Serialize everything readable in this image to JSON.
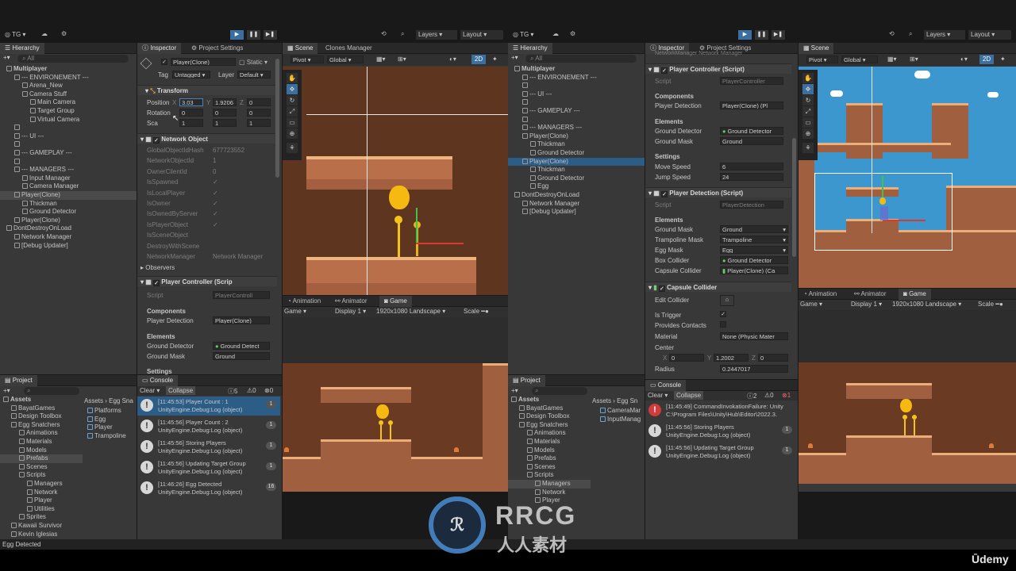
{
  "watermark": {
    "text": "RRCG",
    "sub": "人人素材",
    "udemy": "Ūdemy"
  },
  "status": {
    "text": "Egg Detected"
  },
  "left": {
    "toolbar": {
      "account": "TG",
      "layers": "Layers",
      "layout": "Layout"
    },
    "hierarchy": {
      "tab": "Hierarchy",
      "search": "All",
      "items": [
        {
          "label": "Multiplayer",
          "indent": 0,
          "bold": true
        },
        {
          "label": "--- ENVIRONEMENT ---",
          "indent": 1
        },
        {
          "label": "Arena_New",
          "indent": 2
        },
        {
          "label": "Camera Stuff",
          "indent": 2
        },
        {
          "label": "Main Camera",
          "indent": 3
        },
        {
          "label": "Target Group",
          "indent": 3
        },
        {
          "label": "Virtual Camera",
          "indent": 3
        },
        {
          "label": "",
          "indent": 1
        },
        {
          "label": "--- UI ---",
          "indent": 1
        },
        {
          "label": "",
          "indent": 1
        },
        {
          "label": "--- GAMEPLAY ---",
          "indent": 1
        },
        {
          "label": "",
          "indent": 1
        },
        {
          "label": "--- MANAGERS ---",
          "indent": 1
        },
        {
          "label": "Input Manager",
          "indent": 2
        },
        {
          "label": "Camera Manager",
          "indent": 2
        },
        {
          "label": "Player(Clone)",
          "indent": 1,
          "hl": true
        },
        {
          "label": "Thickman",
          "indent": 2
        },
        {
          "label": "Ground Detector",
          "indent": 2
        },
        {
          "label": "Player(Clone)",
          "indent": 1
        },
        {
          "label": "DontDestroyOnLoad",
          "indent": 0
        },
        {
          "label": "Network Manager",
          "indent": 1
        },
        {
          "label": "[Debug Updater]",
          "indent": 1
        }
      ]
    },
    "inspector": {
      "tabs": [
        "Inspector",
        "Project Settings"
      ],
      "object": "Player(Clone)",
      "static": "Static",
      "tag_label": "Tag",
      "tag": "Untagged",
      "layer_label": "Layer",
      "layer": "Default",
      "transform": {
        "title": "Transform",
        "position": "Position",
        "rotation": "Rotation",
        "scale": "Sca",
        "px": "3.03",
        "py": "1.9206",
        "pz": "0",
        "rx": "0",
        "ry": "0",
        "rz": "0",
        "sx": "1",
        "sy": "1",
        "sz": "1"
      },
      "network": {
        "title": "Network Object",
        "fields": [
          {
            "k": "GlobalObjectIdHash",
            "v": "677723552"
          },
          {
            "k": "NetworkObjectId",
            "v": "1"
          },
          {
            "k": "OwnerClientId",
            "v": "0"
          },
          {
            "k": "IsSpawned",
            "v": "✓"
          },
          {
            "k": "IsLocalPlayer",
            "v": "✓"
          },
          {
            "k": "IsOwner",
            "v": "✓"
          },
          {
            "k": "IsOwnedByServer",
            "v": "✓"
          },
          {
            "k": "IsPlayerObject",
            "v": "✓"
          },
          {
            "k": "IsSceneObject",
            "v": ""
          },
          {
            "k": "DestroyWithScene",
            "v": ""
          },
          {
            "k": "NetworkManager",
            "v": "Network Manager"
          }
        ]
      },
      "observers": "Observers",
      "player_controller": {
        "title": "Player Controller (Scrip",
        "script_label": "Script",
        "script": "PlayerControll",
        "components": "Components",
        "player_detection_label": "Player Detection",
        "player_detection": "Player(Clone)",
        "elements": "Elements",
        "ground_detector_label": "Ground Detector",
        "ground_detector": "Ground Detect",
        "ground_mask_label": "Ground Mask",
        "ground_mask": "Ground",
        "settings": "Settings"
      }
    },
    "scene": {
      "tabs": [
        "Scene",
        "Clones Manager"
      ],
      "pivot": "Pivot",
      "global": "Global",
      "mode2d": "2D"
    },
    "game": {
      "tabs": [
        "Animation",
        "Animator",
        "Game"
      ],
      "display_mode": "Game",
      "display": "Display 1",
      "resolution": "1920x1080 Landscape",
      "scale": "Scale"
    },
    "project": {
      "tab": "Project",
      "breadcrumb": [
        "Assets",
        "Egg Sna"
      ],
      "tree": [
        {
          "label": "Assets",
          "indent": 0,
          "bold": true
        },
        {
          "label": "BayatGames",
          "indent": 1
        },
        {
          "label": "Design Toolbox",
          "indent": 1
        },
        {
          "label": "Egg Snatchers",
          "indent": 1
        },
        {
          "label": "Animations",
          "indent": 2
        },
        {
          "label": "Materials",
          "indent": 2
        },
        {
          "label": "Models",
          "indent": 2
        },
        {
          "label": "Prefabs",
          "indent": 2,
          "hl": true
        },
        {
          "label": "Scenes",
          "indent": 2
        },
        {
          "label": "Scripts",
          "indent": 2
        },
        {
          "label": "Managers",
          "indent": 3
        },
        {
          "label": "Network",
          "indent": 3
        },
        {
          "label": "Player",
          "indent": 3
        },
        {
          "label": "Utilities",
          "indent": 3
        },
        {
          "label": "Sprites",
          "indent": 2
        },
        {
          "label": "Kawaii Survivor",
          "indent": 1
        },
        {
          "label": "Kevin Iglesias",
          "indent": 1
        }
      ],
      "files": [
        "Platforms",
        "Egg",
        "Player",
        "Trampoline"
      ]
    },
    "console": {
      "tab": "Console",
      "clear": "Clear",
      "collapse": "Collapse",
      "c_info": "5",
      "c_warn": "0",
      "c_err": "0",
      "messages": [
        {
          "time": "[11:45:53] Player Count : 1",
          "src": "UnityEngine.Debug:Log (object)",
          "count": "1",
          "sel": true
        },
        {
          "time": "[11:45:56] Player Count : 2",
          "src": "UnityEngine.Debug:Log (object)",
          "count": "1"
        },
        {
          "time": "[11:45:56] Storing Players",
          "src": "UnityEngine.Debug:Log (object)",
          "count": "1"
        },
        {
          "time": "[11:45:56] Updating Target Group",
          "src": "UnityEngine.Debug:Log (object)",
          "count": "1"
        },
        {
          "time": "[11:46:26] Egg Detected",
          "src": "UnityEngine.Debug:Log (object)",
          "count": "16"
        }
      ]
    }
  },
  "right": {
    "toolbar": {
      "account": "TG",
      "layers": "Layers",
      "layout": "Layout"
    },
    "hierarchy": {
      "tab": "Hierarchy",
      "search": "All",
      "items": [
        {
          "label": "Multiplayer",
          "indent": 0,
          "bold": true
        },
        {
          "label": "--- ENVIRONEMENT ---",
          "indent": 1
        },
        {
          "label": "",
          "indent": 1
        },
        {
          "label": "--- UI ---",
          "indent": 1
        },
        {
          "label": "",
          "indent": 1
        },
        {
          "label": "--- GAMEPLAY ---",
          "indent": 1
        },
        {
          "label": "",
          "indent": 1
        },
        {
          "label": "--- MANAGERS ---",
          "indent": 1
        },
        {
          "label": "Player(Clone)",
          "indent": 1
        },
        {
          "label": "Thickman",
          "indent": 2
        },
        {
          "label": "Ground Detector",
          "indent": 2
        },
        {
          "label": "Player(Clone)",
          "indent": 1,
          "sel": true
        },
        {
          "label": "Thickman",
          "indent": 2
        },
        {
          "label": "Ground Detector",
          "indent": 2
        },
        {
          "label": "Egg",
          "indent": 2
        },
        {
          "label": "DontDestroyOnLoad",
          "indent": 0
        },
        {
          "label": "Network Manager",
          "indent": 1
        },
        {
          "label": "[Debug Updater]",
          "indent": 1
        }
      ]
    },
    "inspector": {
      "tabs": [
        "Inspector",
        "Project Settings"
      ],
      "ghost": "NetworkManager   Network Manager",
      "player_controller": {
        "title": "Player Controller (Script)",
        "script_label": "Script",
        "script": "PlayerController",
        "components": "Components",
        "player_detection_label": "Player Detection",
        "player_detection": "Player(Clone) (Pl",
        "elements": "Elements",
        "ground_detector_label": "Ground Detector",
        "ground_detector": "Ground Detector",
        "ground_mask_label": "Ground Mask",
        "ground_mask": "Ground",
        "settings": "Settings",
        "move_speed_label": "Move Speed",
        "move_speed": "6",
        "jump_speed_label": "Jump Speed",
        "jump_speed": "24"
      },
      "player_detection": {
        "title": "Player Detection (Script)",
        "script_label": "Script",
        "script": "PlayerDetection",
        "elements": "Elements",
        "ground_mask_label": "Ground Mask",
        "ground_mask": "Ground",
        "trampoline_mask_label": "Trampoline Mask",
        "trampoline_mask": "Trampoline",
        "egg_mask_label": "Egg Mask",
        "egg_mask": "Egg",
        "box_collider_label": "Box Collider",
        "box_collider": "Ground Detector",
        "capsule_collider_label": "Capsule Collider",
        "capsule_collider": "Player(Clone) (Ca"
      },
      "capsule": {
        "title": "Capsule Collider",
        "edit_label": "Edit Collider",
        "trigger_label": "Is Trigger",
        "contacts_label": "Provides Contacts",
        "material_label": "Material",
        "material": "None (Physic Mater",
        "center_label": "Center",
        "cx": "0",
        "cy": "1.2002",
        "cz": "0",
        "radius_label": "Radius",
        "radius": "0.2447017"
      }
    },
    "scene": {
      "tabs": [
        "Scene"
      ],
      "pivot": "Pivot",
      "global": "Global",
      "mode2d": "2D"
    },
    "game": {
      "tabs": [
        "Animation",
        "Animator",
        "Game"
      ],
      "display_mode": "Game",
      "display": "Display 1",
      "resolution": "1920x1080 Landscape",
      "scale": "Scale"
    },
    "project": {
      "tab": "Project",
      "breadcrumb": [
        "Assets",
        "Egg Sn"
      ],
      "tree": [
        {
          "label": "Assets",
          "indent": 0,
          "bold": true
        },
        {
          "label": "BayatGames",
          "indent": 1
        },
        {
          "label": "Design Toolbox",
          "indent": 1
        },
        {
          "label": "Egg Snatchers",
          "indent": 1
        },
        {
          "label": "Animations",
          "indent": 2
        },
        {
          "label": "Materials",
          "indent": 2
        },
        {
          "label": "Models",
          "indent": 2
        },
        {
          "label": "Prefabs",
          "indent": 2
        },
        {
          "label": "Scenes",
          "indent": 2
        },
        {
          "label": "Scripts",
          "indent": 2
        },
        {
          "label": "Managers",
          "indent": 3,
          "hl": true
        },
        {
          "label": "Network",
          "indent": 3
        },
        {
          "label": "Player",
          "indent": 3
        }
      ],
      "files": [
        "CameraMar",
        "InputManag"
      ]
    },
    "console": {
      "tab": "Console",
      "clear": "Clear",
      "collapse": "Collapse",
      "c_info": "2",
      "c_warn": "0",
      "c_err": "1",
      "messages": [
        {
          "time": "[11:45:49] CommandInvokationFailure: Unity",
          "src": "C:\\Program Files\\Unity\\Hub\\Editor\\2022.3.",
          "count": "",
          "err": true
        },
        {
          "time": "[11:45:56] Storing Players",
          "src": "UnityEngine.Debug:Log (object)",
          "count": "1"
        },
        {
          "time": "[11:45:56] Updating Target Group",
          "src": "UnityEngine.Debug:Log (object)",
          "count": "1"
        }
      ]
    }
  }
}
